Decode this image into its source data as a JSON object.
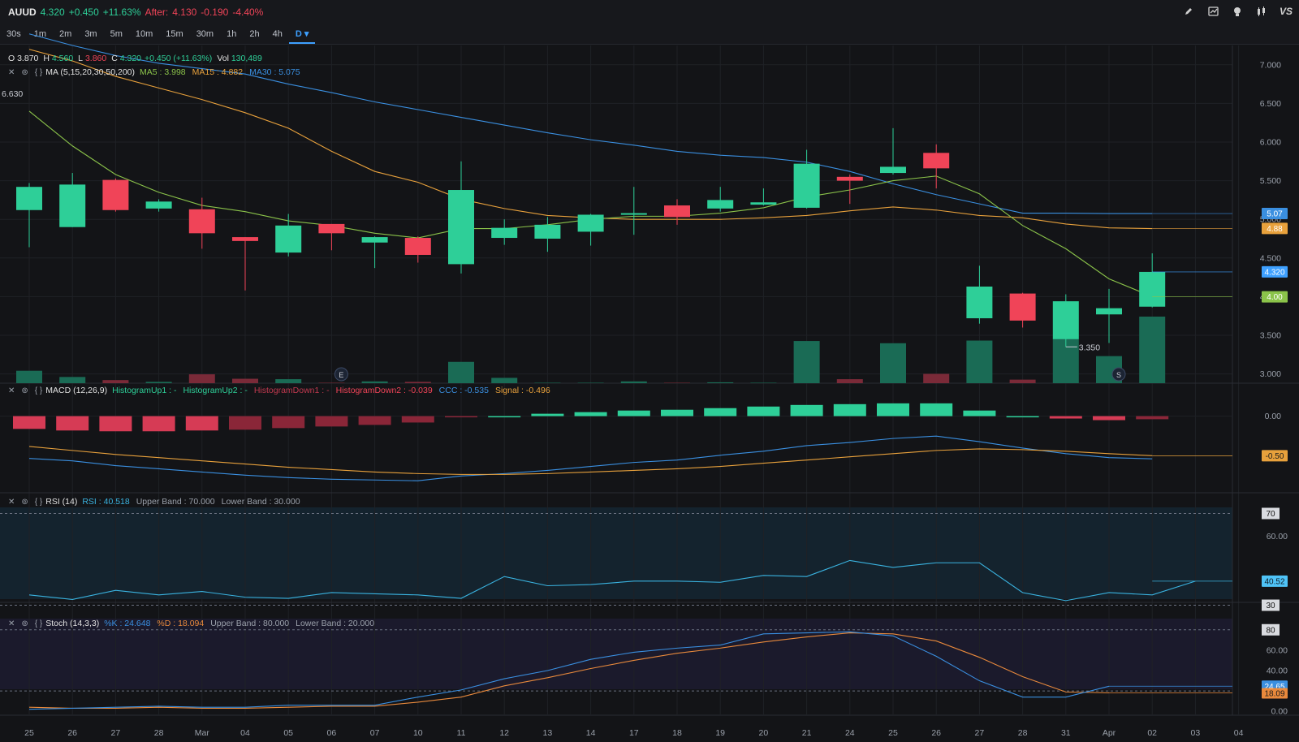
{
  "ticker": {
    "symbol": "AUUD",
    "price": "4.320",
    "change": "+0.450",
    "change_pct": "+11.63%",
    "after_label": "After:",
    "after_price": "4.130",
    "after_change": "-0.190",
    "after_pct": "-4.40%"
  },
  "toolbar_icons": [
    "pencil-icon",
    "chart-icon",
    "lightbulb-icon",
    "candles-icon",
    "compare-icon"
  ],
  "toolbar_vs_label": "VS",
  "timeframes": [
    "30s",
    "1m",
    "2m",
    "3m",
    "5m",
    "10m",
    "15m",
    "30m",
    "1h",
    "2h",
    "4h",
    "D"
  ],
  "active_timeframe": "D",
  "ohlc": {
    "o_label": "O",
    "o": "3.870",
    "h_label": "H",
    "h": "4.560",
    "l_label": "L",
    "l": "3.860",
    "c_label": "C",
    "c": "4.320",
    "chg": "+0.450 (+11.63%)",
    "vol_label": "Vol",
    "vol": "130,489"
  },
  "ma_legend": {
    "name": "MA (5,15,20,30,50,200)",
    "ma5": "MA5 : 3.998",
    "ma15": "MA15 : 4.882",
    "ma30": "MA30 : 5.075"
  },
  "macd_legend": {
    "name": "MACD (12,26,9)",
    "hup1": "HistogramUp1 : -",
    "hup2": "HistogramUp2 : -",
    "hdn1": "HistogramDown1 : -",
    "hdn2": "HistogramDown2 : -0.039",
    "ccc": "CCC : -0.535",
    "signal": "Signal : -0.496"
  },
  "rsi_legend": {
    "name": "RSI (14)",
    "rsi": "RSI : 40.518",
    "upper": "Upper Band : 70.000",
    "lower": "Lower Band : 30.000"
  },
  "stoch_legend": {
    "name": "Stoch (14,3,3)",
    "k": "%K : 24.648",
    "d": "%D : 18.094",
    "upper": "Upper Band : 80.000",
    "lower": "Lower Band : 20.000"
  },
  "colors": {
    "up": "#2ecf98",
    "down": "#f04458",
    "ma5": "#8bc34a",
    "ma15": "#e8a13c",
    "ma30": "#3a8fe0",
    "rsi": "#3ab3e0",
    "stoch_k": "#3a8fe0",
    "stoch_d": "#e8893c"
  },
  "chart_data": {
    "type": "candlestick",
    "x_labels": [
      "25",
      "26",
      "27",
      "28",
      "Mar",
      "04",
      "05",
      "06",
      "07",
      "10",
      "11",
      "12",
      "13",
      "14",
      "17",
      "18",
      "19",
      "20",
      "21",
      "24",
      "25",
      "26",
      "27",
      "28",
      "31",
      "Apr",
      "02",
      "03",
      "04"
    ],
    "price_axis": {
      "ticks": [
        "7.000",
        "6.500",
        "6.000",
        "5.500",
        "5.000",
        "4.500",
        "4.000",
        "3.500",
        "3.000"
      ],
      "ylim": [
        2.88,
        7.25
      ]
    },
    "candles": [
      {
        "o": 5.12,
        "h": 5.47,
        "l": 4.64,
        "c": 5.42
      },
      {
        "o": 4.9,
        "h": 5.6,
        "l": 4.9,
        "c": 5.45
      },
      {
        "o": 5.51,
        "h": 5.53,
        "l": 5.1,
        "c": 5.12
      },
      {
        "o": 5.14,
        "h": 5.26,
        "l": 5.1,
        "c": 5.23
      },
      {
        "o": 5.13,
        "h": 5.28,
        "l": 4.62,
        "c": 4.82
      },
      {
        "o": 4.77,
        "h": 4.77,
        "l": 4.08,
        "c": 4.72
      },
      {
        "o": 4.57,
        "h": 5.07,
        "l": 4.52,
        "c": 4.92
      },
      {
        "o": 4.94,
        "h": 4.94,
        "l": 4.6,
        "c": 4.82
      },
      {
        "o": 4.7,
        "h": 4.78,
        "l": 4.37,
        "c": 4.77
      },
      {
        "o": 4.76,
        "h": 4.78,
        "l": 4.44,
        "c": 4.54
      },
      {
        "o": 4.42,
        "h": 5.75,
        "l": 4.3,
        "c": 5.38
      },
      {
        "o": 4.76,
        "h": 5.0,
        "l": 4.67,
        "c": 4.89
      },
      {
        "o": 4.75,
        "h": 5.03,
        "l": 4.58,
        "c": 4.93
      },
      {
        "o": 4.84,
        "h": 5.07,
        "l": 4.66,
        "c": 5.06
      },
      {
        "o": 5.06,
        "h": 5.42,
        "l": 4.8,
        "c": 5.08
      },
      {
        "o": 5.18,
        "h": 5.26,
        "l": 4.93,
        "c": 5.03
      },
      {
        "o": 5.14,
        "h": 5.42,
        "l": 5.1,
        "c": 5.25
      },
      {
        "o": 5.19,
        "h": 5.4,
        "l": 5.18,
        "c": 5.22
      },
      {
        "o": 5.15,
        "h": 5.9,
        "l": 5.14,
        "c": 5.72
      },
      {
        "o": 5.55,
        "h": 5.58,
        "l": 5.2,
        "c": 5.5
      },
      {
        "o": 5.6,
        "h": 6.18,
        "l": 5.58,
        "c": 5.68
      },
      {
        "o": 5.86,
        "h": 5.97,
        "l": 5.4,
        "c": 5.66
      },
      {
        "o": 3.72,
        "h": 4.4,
        "l": 3.65,
        "c": 4.13
      },
      {
        "o": 4.04,
        "h": 4.05,
        "l": 3.6,
        "c": 3.69
      },
      {
        "o": 3.45,
        "h": 4.03,
        "l": 3.35,
        "c": 3.94
      },
      {
        "o": 3.77,
        "h": 4.1,
        "l": 3.4,
        "c": 3.85
      },
      {
        "o": 3.87,
        "h": 4.56,
        "l": 3.86,
        "c": 4.32
      }
    ],
    "volume": [
      0.28,
      0.14,
      0.07,
      0.03,
      0.2,
      0.1,
      0.09,
      0.01,
      0.04,
      0.03,
      0.48,
      0.12,
      0.01,
      0.01,
      0.04,
      0.01,
      0.02,
      0.01,
      0.95,
      0.09,
      0.9,
      0.21,
      0.96,
      0.08,
      1.0,
      0.61,
      1.5
    ],
    "ma5": [
      6.4,
      5.95,
      5.58,
      5.35,
      5.18,
      5.1,
      4.98,
      4.92,
      4.82,
      4.76,
      4.88,
      4.88,
      4.93,
      5.0,
      5.04,
      5.04,
      5.08,
      5.15,
      5.29,
      5.38,
      5.5,
      5.56,
      5.33,
      4.92,
      4.62,
      4.23,
      4.0
    ],
    "ma15": [
      7.2,
      7.05,
      6.85,
      6.7,
      6.55,
      6.38,
      6.18,
      5.88,
      5.62,
      5.48,
      5.26,
      5.14,
      5.05,
      5.02,
      5.0,
      5.0,
      5.0,
      5.02,
      5.05,
      5.11,
      5.16,
      5.12,
      5.05,
      5.02,
      4.94,
      4.89,
      4.88
    ],
    "ma30": [
      7.4,
      7.25,
      7.12,
      7.02,
      6.95,
      6.88,
      6.75,
      6.64,
      6.52,
      6.42,
      6.32,
      6.22,
      6.12,
      6.03,
      5.96,
      5.88,
      5.83,
      5.8,
      5.74,
      5.62,
      5.46,
      5.32,
      5.2,
      5.08,
      5.08,
      5.075,
      5.075
    ],
    "annotations": [
      "6.630",
      "3.350"
    ],
    "event_markers": [
      "E",
      "S"
    ],
    "price_tags": [
      {
        "label": "5.07",
        "value": 5.075,
        "color": "#3a8fe0"
      },
      {
        "label": "4.88",
        "value": 4.882,
        "color": "#e8a13c"
      },
      {
        "label": "4.320",
        "value": 4.32,
        "color": "#3ea0ff"
      },
      {
        "label": "4.00",
        "value": 3.998,
        "color": "#8bc34a"
      }
    ],
    "macd": {
      "tick": "0.00",
      "tag": "-0.50",
      "ylim": [
        -0.95,
        0.25
      ],
      "histogram": [
        -0.16,
        -0.18,
        -0.19,
        -0.19,
        -0.18,
        -0.17,
        -0.15,
        -0.13,
        -0.11,
        -0.08,
        -0.01,
        0.0,
        0.03,
        0.05,
        0.07,
        0.08,
        0.1,
        0.12,
        0.14,
        0.15,
        0.16,
        0.16,
        0.07,
        0.0,
        -0.03,
        -0.05,
        -0.039
      ],
      "ccc": [
        -0.53,
        -0.56,
        -0.62,
        -0.66,
        -0.7,
        -0.74,
        -0.77,
        -0.79,
        -0.8,
        -0.81,
        -0.75,
        -0.72,
        -0.68,
        -0.63,
        -0.58,
        -0.55,
        -0.49,
        -0.44,
        -0.37,
        -0.33,
        -0.28,
        -0.25,
        -0.32,
        -0.4,
        -0.47,
        -0.52,
        -0.535
      ],
      "signal": [
        -0.38,
        -0.43,
        -0.48,
        -0.52,
        -0.56,
        -0.6,
        -0.64,
        -0.67,
        -0.7,
        -0.72,
        -0.73,
        -0.73,
        -0.72,
        -0.7,
        -0.68,
        -0.66,
        -0.63,
        -0.59,
        -0.55,
        -0.51,
        -0.47,
        -0.43,
        -0.41,
        -0.42,
        -0.44,
        -0.47,
        -0.496
      ]
    },
    "rsi": {
      "ticks": [
        "70",
        "60.00",
        "30"
      ],
      "tag": "40.52",
      "ylim": [
        27,
        73
      ],
      "values": [
        34.5,
        32.5,
        36.5,
        34.5,
        36.0,
        33.5,
        33.0,
        35.5,
        35.0,
        34.5,
        33.0,
        42.5,
        38.5,
        39.0,
        40.5,
        40.5,
        40.0,
        43.0,
        42.5,
        49.5,
        46.5,
        48.5,
        48.5,
        35.5,
        32.0,
        35.5,
        34.5,
        40.5
      ]
    },
    "stoch": {
      "ticks": [
        "80",
        "60.00",
        "40.00",
        "20.00",
        "0.00"
      ],
      "tags": [
        "24.65",
        "18.09"
      ],
      "ylim": [
        -3,
        83
      ],
      "k": [
        2,
        3,
        4,
        5,
        4,
        4,
        6,
        6,
        6,
        14,
        21,
        32,
        40,
        51,
        58,
        62,
        65,
        76,
        77,
        78,
        74,
        54,
        30,
        14,
        14,
        24.648
      ],
      "d": [
        4,
        3,
        3,
        4,
        3,
        3,
        4,
        5,
        5,
        9,
        14,
        25,
        33,
        42,
        50,
        57,
        62,
        68,
        73,
        77,
        76,
        69,
        53,
        34,
        19,
        18.094
      ]
    }
  }
}
